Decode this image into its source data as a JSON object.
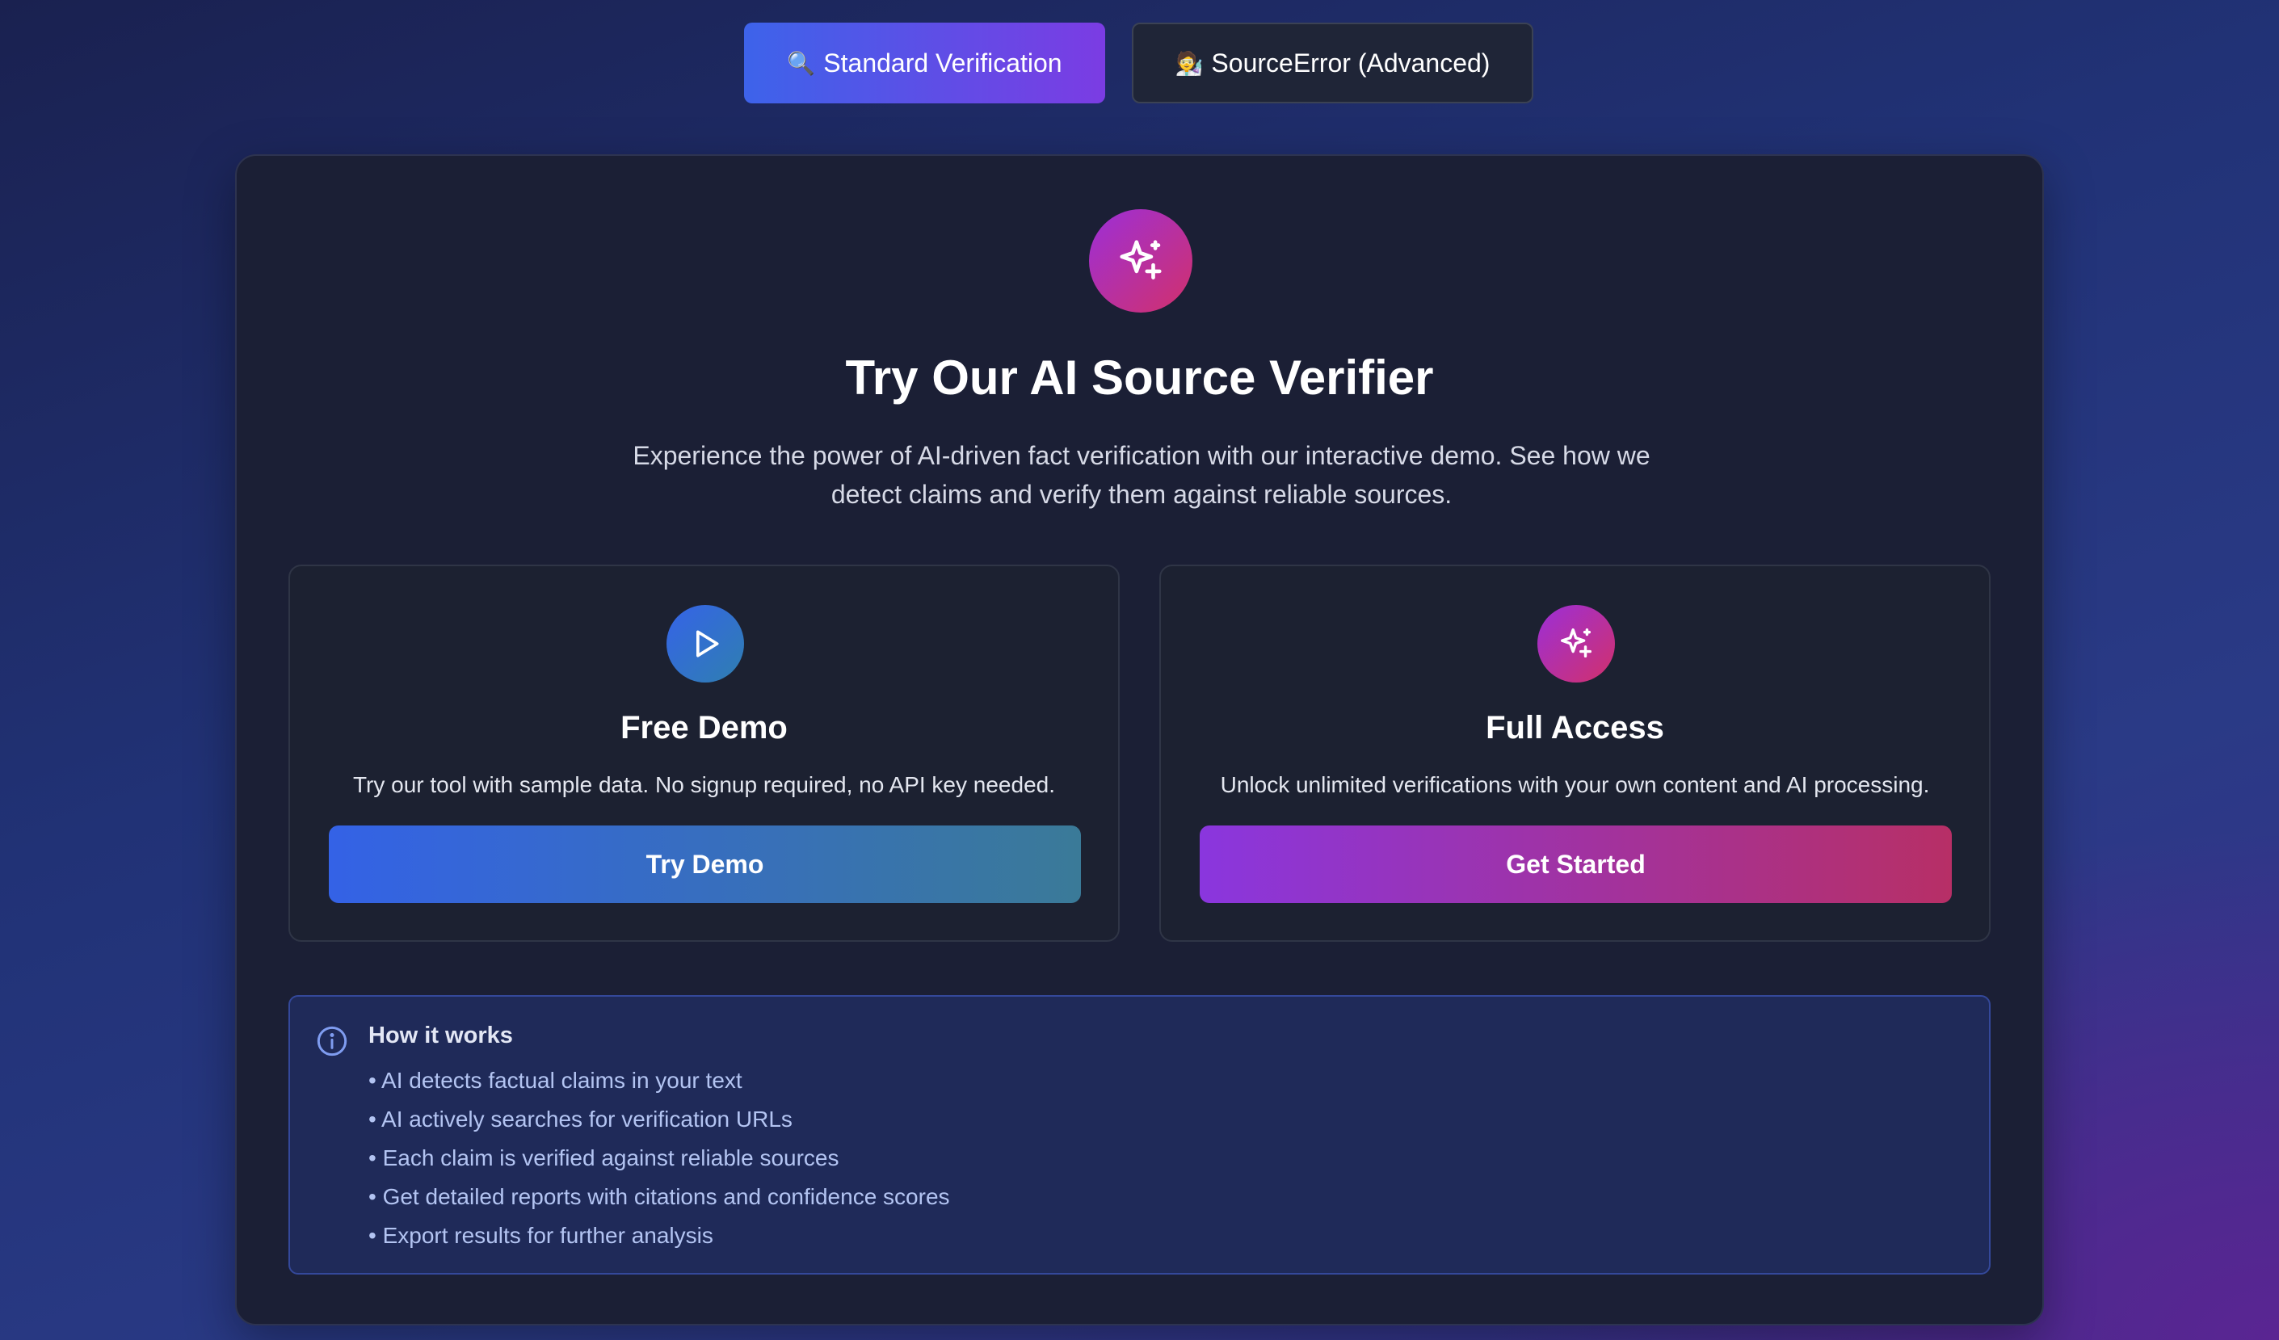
{
  "tabs": [
    {
      "label": "Standard Verification",
      "icon": "magnifier-icon",
      "glyph": "🔍",
      "active": true
    },
    {
      "label": "SourceError (Advanced)",
      "icon": "scientist-icon",
      "glyph": "🧑‍🔬",
      "active": false
    }
  ],
  "hero": {
    "icon": "sparkles-icon",
    "title": "Try Our AI Source Verifier",
    "subtitle": "Experience the power of AI-driven fact verification with our interactive demo. See how we detect claims and verify them against reliable sources."
  },
  "options": [
    {
      "icon": "play-icon",
      "title": "Free Demo",
      "description": "Try our tool with sample data. No signup required, no API key needed.",
      "button_label": "Try Demo"
    },
    {
      "icon": "sparkles-icon",
      "title": "Full Access",
      "description": "Unlock unlimited verifications with your own content and AI processing.",
      "button_label": "Get Started"
    }
  ],
  "how_it_works": {
    "icon": "info-icon",
    "title": "How it works",
    "items": [
      "• AI detects factual claims in your text",
      "• AI actively searches for verification URLs",
      "• Each claim is verified against reliable sources",
      "• Get detailed reports with citations and confidence scores",
      "• Export results for further analysis"
    ]
  },
  "colors": {
    "primary_gradient_start": "#3d63ea",
    "primary_gradient_end": "#7b3ce3",
    "pink_accent": "#d2306b",
    "card_bg": "#1b1f35",
    "info_text": "#b3c4f2"
  }
}
